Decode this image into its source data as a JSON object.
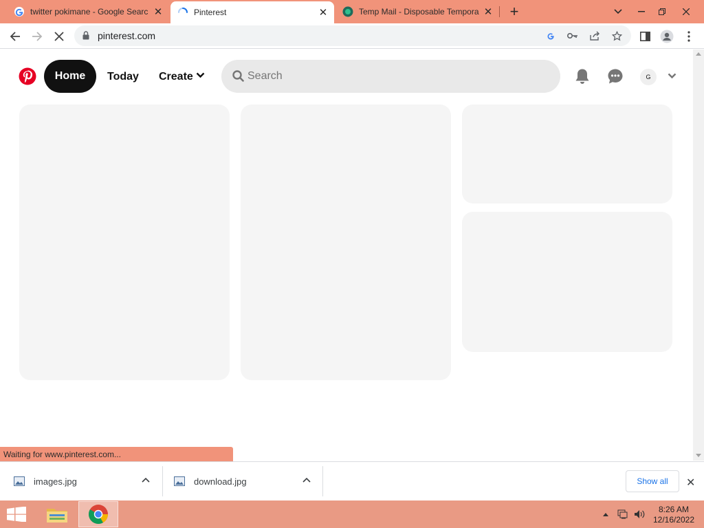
{
  "browser": {
    "tabs": [
      {
        "title": "twitter pokimane - Google Searc",
        "favicon": "google-icon",
        "active": false
      },
      {
        "title": "Pinterest",
        "favicon": "loading-spinner-icon",
        "active": true
      },
      {
        "title": "Temp Mail - Disposable Tempora",
        "favicon": "temp-mail-icon",
        "active": false
      }
    ],
    "url": "pinterest.com"
  },
  "pinterest": {
    "nav": {
      "home": "Home",
      "today": "Today",
      "create": "Create"
    },
    "search": {
      "placeholder": "Search",
      "value": ""
    },
    "avatar_initial": "G"
  },
  "status_text": "Waiting for www.pinterest.com...",
  "downloads": {
    "items": [
      {
        "name": "images.jpg"
      },
      {
        "name": "download.jpg"
      }
    ],
    "show_all": "Show all"
  },
  "taskbar": {
    "time": "8:26 AM",
    "date": "12/16/2022"
  },
  "colors": {
    "tabstrip": "#f1937a",
    "pinterest_red": "#e60023",
    "home_pill": "#111111",
    "skeleton": "#f5f5f5",
    "taskbar": "#e99a84"
  }
}
